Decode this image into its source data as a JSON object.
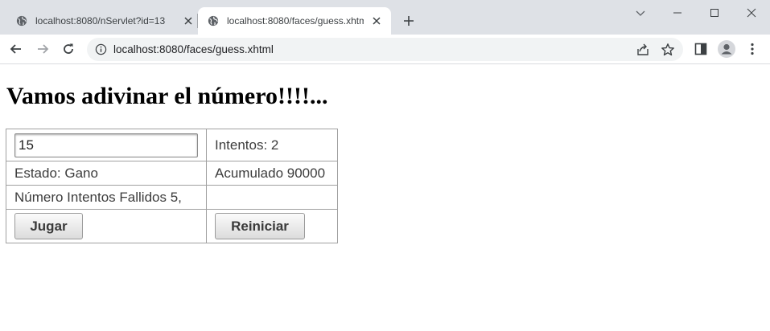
{
  "browser": {
    "tabs": [
      {
        "title": "localhost:8080/nServlet?id=13",
        "active": false
      },
      {
        "title": "localhost:8080/faces/guess.xhtml",
        "active": true
      }
    ],
    "url": "localhost:8080/faces/guess.xhtml",
    "icons": [
      "globe-icon",
      "close-icon",
      "plus-icon",
      "chevron-down-icon",
      "minimize-icon",
      "maximize-icon",
      "window-close-icon",
      "back-arrow-icon",
      "forward-arrow-icon",
      "reload-icon",
      "info-icon",
      "share-icon",
      "star-icon",
      "side-panel-icon",
      "profile-icon",
      "kebab-menu-icon"
    ]
  },
  "page": {
    "heading": "Vamos adivinar el número!!!!...",
    "guess_value": "15",
    "intentos": "Intentos: 2",
    "estado": "Estado: Gano",
    "acumulado": "Acumulado 90000",
    "fallidos": "Número Intentos Fallidos 5,",
    "empty_cell": "",
    "jugar_label": "Jugar",
    "reiniciar_label": "Reiniciar"
  },
  "colors": {
    "tabstrip_bg": "#dee1e6",
    "omnibox_bg": "#f1f3f4",
    "cell_border": "#a0a0a0"
  }
}
